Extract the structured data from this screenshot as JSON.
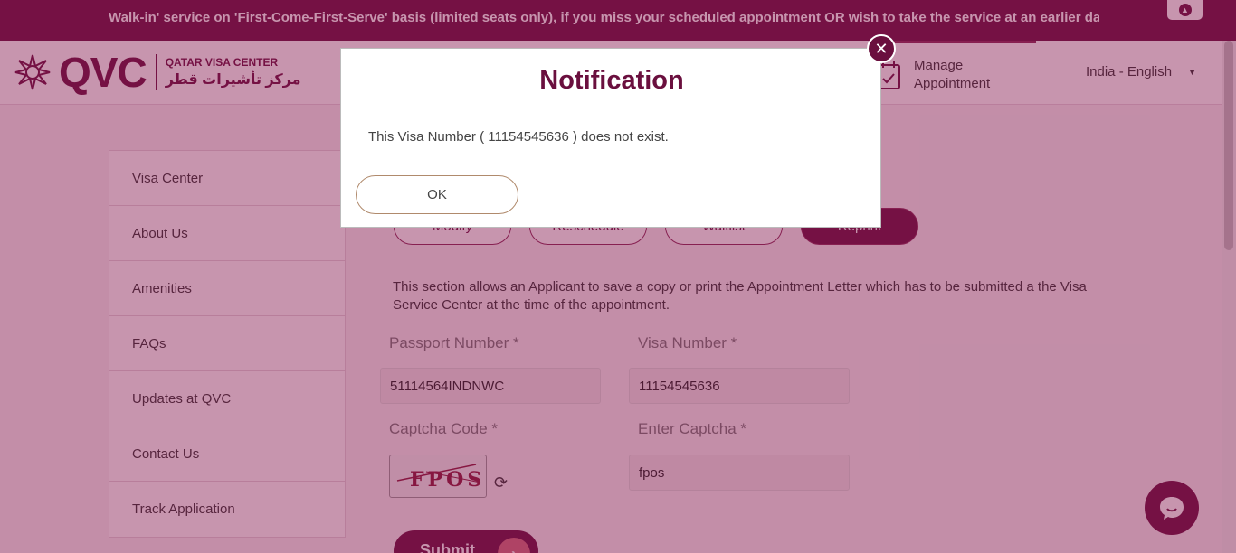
{
  "ticker": {
    "text": "Walk-in' service on 'First-Come-First-Serve' basis (limited seats only), if you miss your scheduled appointment OR wish to take the service at an earlier date /",
    "toggle_icon": "chevron-up-icon"
  },
  "header": {
    "logo_text": "QVC",
    "logo_en": "QATAR VISA CENTER",
    "logo_ar": "مركز تأشيرات قطر",
    "manage_label": "Manage Appointment",
    "language": "India - English"
  },
  "sidebar": {
    "items": [
      {
        "label": "Visa Center"
      },
      {
        "label": "About Us"
      },
      {
        "label": "Amenities"
      },
      {
        "label": "FAQs"
      },
      {
        "label": "Updates at QVC"
      },
      {
        "label": "Contact Us"
      },
      {
        "label": "Track Application"
      }
    ]
  },
  "tabs": [
    {
      "label": "Modify"
    },
    {
      "label": "Reschedule"
    },
    {
      "label": "Waitlist"
    },
    {
      "label": "Reprint",
      "active": true
    }
  ],
  "form": {
    "description": "This section allows an Applicant to save a copy or print the Appointment Letter which has to be submitted a the Visa Service Center at the time of the appointment.",
    "passport_label": "Passport Number *",
    "passport_value": "51114564INDNWC",
    "visa_label": "Visa Number *",
    "visa_value": "11154545636",
    "captcha_label": "Captcha Code *",
    "captcha_image_text": "FPOS",
    "enter_captcha_label": "Enter Captcha *",
    "enter_captcha_value": "fpos",
    "submit_label": "Submit"
  },
  "modal": {
    "title": "Notification",
    "message": "This Visa Number ( 11154545636 ) does not exist.",
    "ok_label": "OK"
  },
  "colors": {
    "brand": "#6a0f3e",
    "overlay": "#82144b"
  }
}
